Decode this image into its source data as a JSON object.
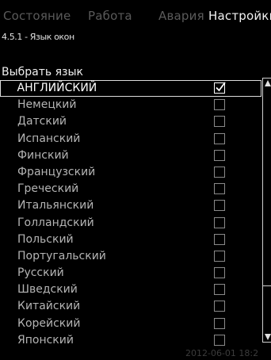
{
  "tabs": [
    {
      "label": "Состояние",
      "active": false
    },
    {
      "label": "Работа",
      "active": false
    },
    {
      "label": "Авария",
      "active": false
    },
    {
      "label": "Настройки",
      "active": true
    }
  ],
  "screen_title": "4.5.1 - Язык окон",
  "section_label": "Выбрать язык",
  "languages": [
    {
      "label": "АНГЛИЙСКИЙ",
      "checked": true,
      "selected": true
    },
    {
      "label": "Немецкий",
      "checked": false
    },
    {
      "label": "Датский",
      "checked": false
    },
    {
      "label": "Испанский",
      "checked": false
    },
    {
      "label": "Финский",
      "checked": false
    },
    {
      "label": "Французский",
      "checked": false
    },
    {
      "label": "Греческий",
      "checked": false
    },
    {
      "label": "Итальянский",
      "checked": false
    },
    {
      "label": "Голландский",
      "checked": false
    },
    {
      "label": "Польский",
      "checked": false
    },
    {
      "label": "Португальский",
      "checked": false
    },
    {
      "label": "Русский",
      "checked": false
    },
    {
      "label": "Шведский",
      "checked": false
    },
    {
      "label": "Китайский",
      "checked": false
    },
    {
      "label": "Корейский",
      "checked": false
    },
    {
      "label": "Японский",
      "checked": false
    }
  ],
  "footer_datetime": "2012-06-01 18:2"
}
